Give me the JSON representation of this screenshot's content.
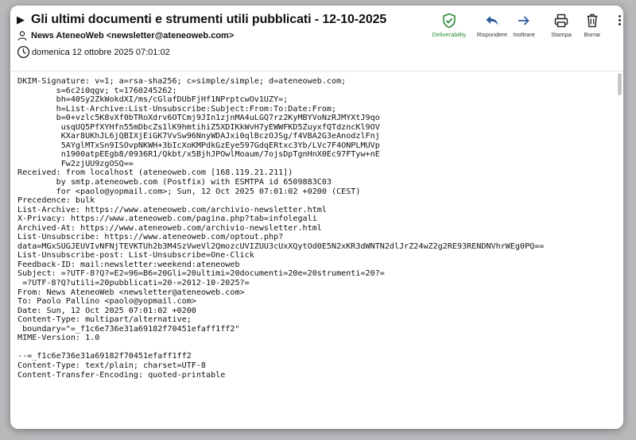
{
  "header": {
    "subject": "Gli ultimi documenti e strumenti utili pubblicati - 12-10-2025",
    "from": "News AteneoWeb <newsletter@ateneoweb.com>",
    "date": "domenica 12 ottobre 2025 07:01:02"
  },
  "toolbar": {
    "deliverability": "Deliverability",
    "reply": "Rispondere",
    "forward": "Inoltrare",
    "print": "Stampa",
    "delete": "Borrar"
  },
  "colors": {
    "deliverability": "#2c8a3a",
    "accent": "#2a5a9a"
  },
  "source_lines": [
    "DKIM-Signature: v=1; a=rsa-sha256; c=simple/simple; d=ateneoweb.com;",
    "        s=6c2i0qgv; t=1760245262;",
    "        bh=40Sy2ZkWokdXI/ms/cGlafDUbFjHf1NPrptcwOv1UZY=;",
    "        h=List-Archive:List-Unsubscribe:Subject:From:To:Date:From;",
    "        b=0+vzlc5K8vXf0bTRoXdrv6OTCmj9JIn1zjnMA4uLGQ7rz2KyMBYVoNzRJMYXtJ9qo",
    "         usqUQ5PfXYHfn55mDbcZs1lK9hmtihiZ5XDIKkWvH7yEWWFKD5ZuyxfQTdzncKl9OV",
    "         KXar8UKhJL6jQBIXjEiGK7VvSw96NnyWDAJxi0qlBczOJSg/f4VBA2G3eAnodzlFnj",
    "         5AYglMTxSn9ISOvpNKWH+3bIcXoKMPdkGzEye597GdqERtxc3Yb/LVc7F4ONPLMUVp",
    "         n1900atpEEgb8/0936R1/Qkbt/x5BjhJPOwlMoaum/7ojsDpTgnHnX0Ec97FTyw+nE",
    "         Fw2zjUU9zgOSQ==",
    "Received: from localhost (ateneoweb.com [168.119.21.211])",
    "        by smtp.ateneoweb.com (Postfix) with ESMTPA id 6509883C03",
    "        for <paolo@yopmail.com>; Sun, 12 Oct 2025 07:01:02 +0200 (CEST)",
    "Precedence: bulk",
    "List-Archive: https://www.ateneoweb.com/archivio-newsletter.html",
    "X-Privacy: https://www.ateneoweb.com/pagina.php?tab=infolegali",
    "Archived-At: https://www.ateneoweb.com/archivio-newsletter.html",
    "List-Unsubscribe: https://www.ateneoweb.com/optout.php?",
    "data=MGxSUGJEUVIvNFNjTEVKTUh2b3M4SzVweVl2QmozcUVIZUU3cUxXQytOd0E5N2xKR3dWNTN2dlJrZ24wZ2g2RE93RENDNVhrWEg0PQ==",
    "List-Unsubscribe-post: List-Unsubscribe=One-Click",
    "Feedback-ID: mail:newsletter:weekend:ateneoweb",
    "Subject: =?UTF-8?Q?=E2=96=B6=20Gli=20ultimi=20documenti=20e=20strumenti=20?=",
    " =?UTF-8?Q?utili=20pubblicati=20-=2012-10-2025?=",
    "From: News AteneoWeb <newsletter@ateneoweb.com>",
    "To: Paolo Pallino <paolo@yopmail.com>",
    "Date: Sun, 12 Oct 2025 07:01:02 +0200",
    "Content-Type: multipart/alternative;",
    " boundary=\"=_f1c6e736e31a69182f70451efaff1ff2\"",
    "MIME-Version: 1.0",
    "",
    "--=_f1c6e736e31a69182f70451efaff1ff2",
    "Content-Type: text/plain; charset=UTF-8",
    "Content-Transfer-Encoding: quoted-printable"
  ]
}
